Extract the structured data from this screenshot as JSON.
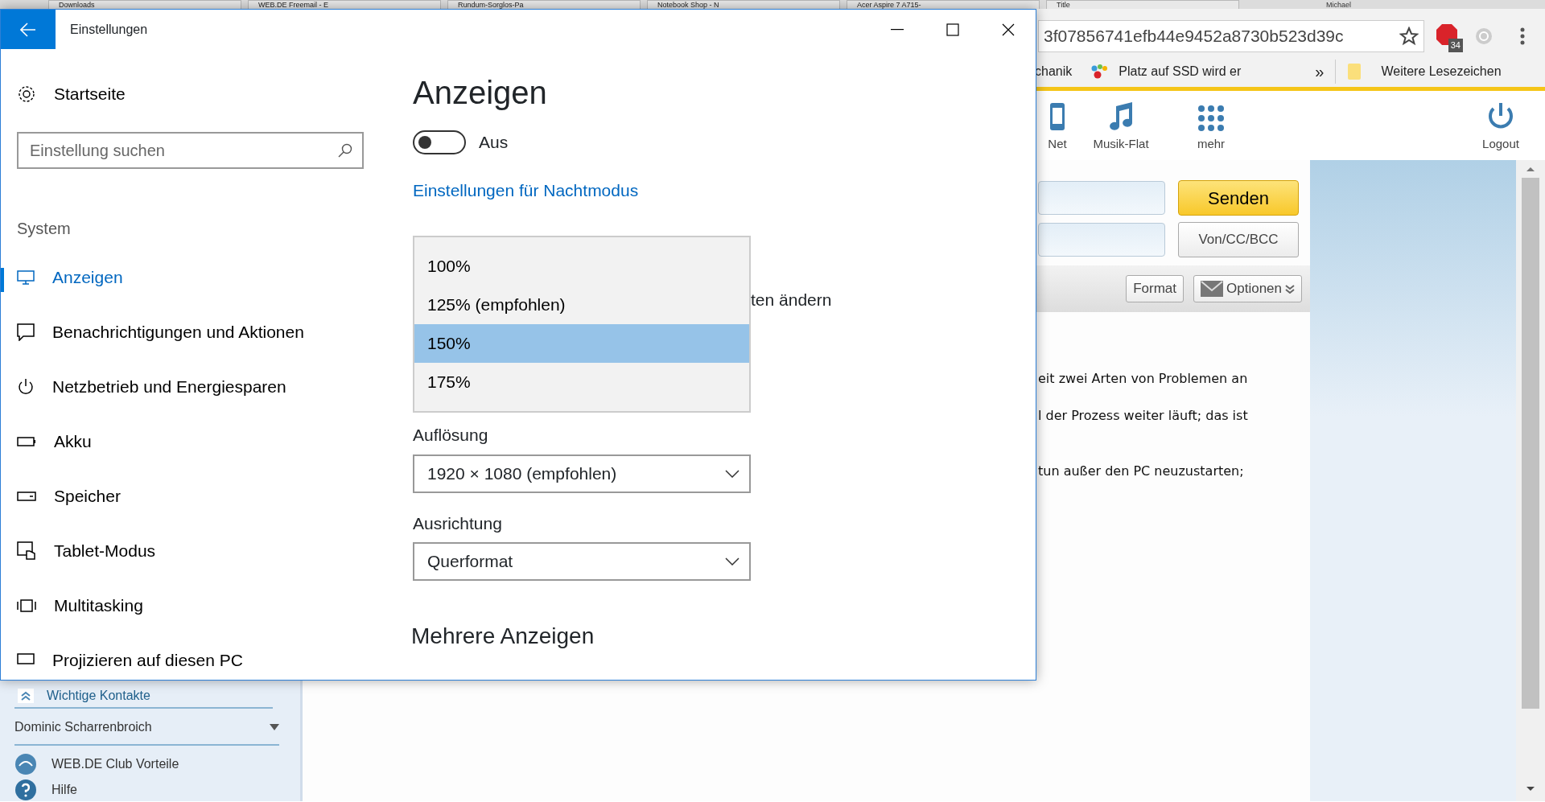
{
  "browser": {
    "tabs": [
      {
        "label": "Downloads"
      },
      {
        "label": "WEB.DE Freemail - E"
      },
      {
        "label": "Rundum-Sorglos-Pa"
      },
      {
        "label": "Notebook Shop - N"
      },
      {
        "label": "Acer Aspire 7 A715-"
      },
      {
        "label": "Title"
      }
    ],
    "profile": "Michael",
    "address": "3f07856741efb44e9452a8730b523d39c",
    "extension_badge": "34",
    "bookmarks": [
      {
        "label": "chanik",
        "kind": "plain"
      },
      {
        "label": "Platz auf SSD wird er",
        "kind": "dots"
      }
    ],
    "bookmarks_overflow": "»",
    "other_bookmarks": "Weitere Lesezeichen",
    "nav": [
      {
        "label": "Net",
        "kind": "phone"
      },
      {
        "label": "Musik-Flat",
        "kind": "music"
      },
      {
        "label": "mehr",
        "kind": "grid"
      },
      {
        "label": "Logout",
        "kind": "power"
      }
    ],
    "compose": {
      "send": "Senden",
      "from_cc_bcc": "Von/CC/BCC",
      "format": "Format",
      "options": "Optionen",
      "lines": [
        "eit zwei Arten von Problemen an",
        "l der Prozess weiter läuft; das ist",
        "tun außer den PC neuzustarten;"
      ]
    },
    "sidebar": {
      "contacts_heading": "Wichtige Kontakte",
      "contact": "Dominic Scharrenbroich",
      "links": [
        {
          "label": "WEB.DE Club Vorteile",
          "kind": "club"
        },
        {
          "label": "Hilfe",
          "kind": "help"
        }
      ]
    }
  },
  "settings": {
    "title": "Einstellungen",
    "home": "Startseite",
    "search_placeholder": "Einstellung suchen",
    "group": "System",
    "nav": [
      {
        "label": "Anzeigen",
        "kind": "display",
        "selected": true
      },
      {
        "label": "Benachrichtigungen und Aktionen",
        "kind": "message",
        "selected": false
      },
      {
        "label": "Netzbetrieb und Energiesparen",
        "kind": "power",
        "selected": false
      },
      {
        "label": "Akku",
        "kind": "battery",
        "selected": false
      },
      {
        "label": "Speicher",
        "kind": "drive",
        "selected": false
      },
      {
        "label": "Tablet-Modus",
        "kind": "tablet",
        "selected": false
      },
      {
        "label": "Multitasking",
        "kind": "multitask",
        "selected": false
      },
      {
        "label": "Projizieren auf diesen PC",
        "kind": "project",
        "selected": false
      }
    ],
    "heading": "Anzeigen",
    "night_light": {
      "on": false,
      "label": "Aus"
    },
    "night_link": "Einstellungen für Nachtmodus",
    "scale_options": [
      {
        "label": "100%",
        "selected": false
      },
      {
        "label": "125% (empfohlen)",
        "selected": false
      },
      {
        "label": "150%",
        "selected": true
      },
      {
        "label": "175%",
        "selected": false
      }
    ],
    "scale_label_tail": "ten ändern",
    "resolution": {
      "label": "Auflösung",
      "value": "1920 × 1080 (empfohlen)"
    },
    "orientation": {
      "label": "Ausrichtung",
      "value": "Querformat"
    },
    "multi_heading": "Mehrere Anzeigen"
  }
}
